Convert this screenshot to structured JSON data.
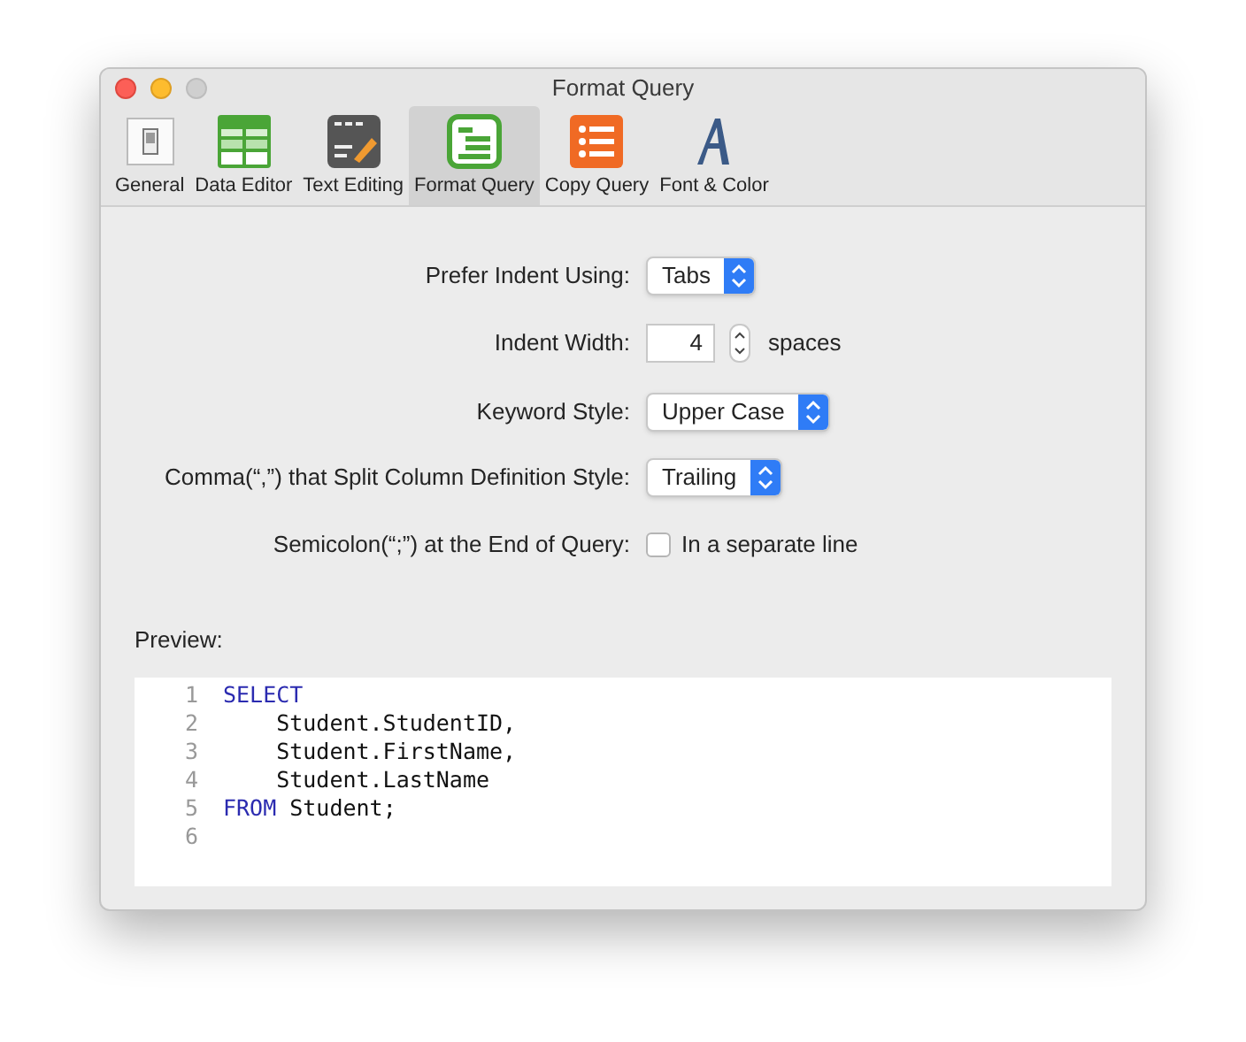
{
  "window": {
    "title": "Format Query"
  },
  "toolbar": [
    {
      "label": "General",
      "selected": false
    },
    {
      "label": "Data Editor",
      "selected": false
    },
    {
      "label": "Text Editing",
      "selected": false
    },
    {
      "label": "Format Query",
      "selected": true
    },
    {
      "label": "Copy Query",
      "selected": false
    },
    {
      "label": "Font & Color",
      "selected": false
    }
  ],
  "settings": [
    {
      "kind": "popup",
      "label": "Prefer Indent Using:",
      "value": "Tabs"
    },
    {
      "kind": "stepper",
      "label": "Indent Width:",
      "value": "4",
      "unit": "spaces"
    },
    {
      "kind": "popup",
      "label": "Keyword Style:",
      "value": "Upper Case"
    },
    {
      "kind": "popup",
      "label": "Comma(“,”) that Split Column Definition Style:",
      "value": "Trailing"
    },
    {
      "kind": "checkbox",
      "label": "Semicolon(“;”) at the End of Query:",
      "option": "In a separate line",
      "checked": false
    }
  ],
  "preview": {
    "label": "Preview:",
    "lines": [
      {
        "number": "1",
        "tokens": [
          {
            "kind": "keyword",
            "text": "SELECT"
          }
        ]
      },
      {
        "number": "2",
        "tokens": [
          {
            "kind": "plain",
            "text": "    Student.StudentID,"
          }
        ]
      },
      {
        "number": "3",
        "tokens": [
          {
            "kind": "plain",
            "text": "    Student.FirstName,"
          }
        ]
      },
      {
        "number": "4",
        "tokens": [
          {
            "kind": "plain",
            "text": "    Student.LastName"
          }
        ]
      },
      {
        "number": "5",
        "tokens": [
          {
            "kind": "keyword",
            "text": "FROM"
          },
          {
            "kind": "plain",
            "text": " Student;"
          }
        ]
      },
      {
        "number": "6"
      }
    ]
  }
}
